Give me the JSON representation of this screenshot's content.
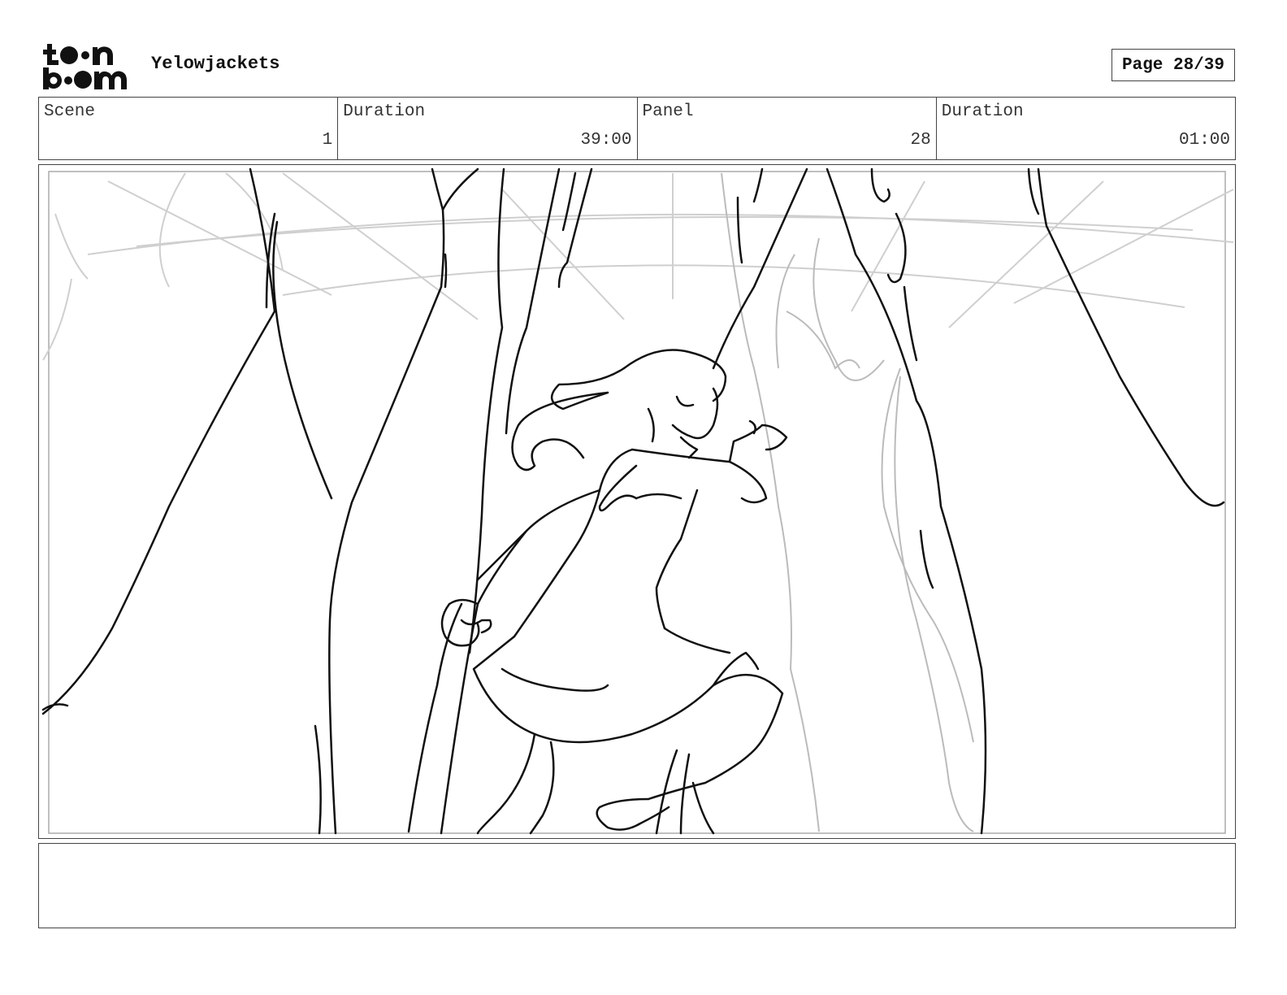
{
  "header": {
    "logo_text_top": "toon",
    "logo_text_bottom": "boom",
    "project_title": "Yelowjackets",
    "page_indicator": "Page 28/39"
  },
  "info": {
    "scene_label": "Scene",
    "scene_value": "1",
    "scene_duration_label": "Duration",
    "scene_duration_value": "39:00",
    "panel_label": "Panel",
    "panel_value": "28",
    "panel_duration_label": "Duration",
    "panel_duration_value": "01:00"
  },
  "notes": {
    "text": ""
  }
}
